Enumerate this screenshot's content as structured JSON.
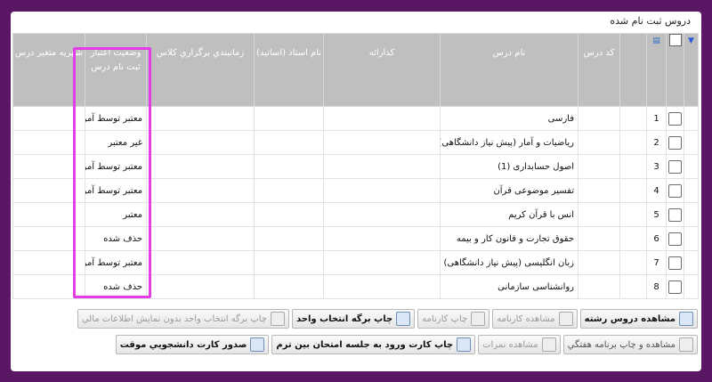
{
  "panel": {
    "title": "دروس ثبت نام شده"
  },
  "table": {
    "headers": {
      "code": "کد درس",
      "name": "نام درس",
      "group": "کدارائه",
      "instructor": "نام استاد (اساتید)",
      "schedule": "زمانبندي برگزاري كلاس",
      "status": "وضعيت اعتبار ثبت نام درس",
      "tuition": "شهريه متغير درس"
    },
    "rows": [
      {
        "num": "1",
        "name": "فارسی",
        "status": "معتبر توسط آموزش"
      },
      {
        "num": "2",
        "name": "رياضيات و آمار (پيش نياز دانشگاهی)",
        "status": "غير معتبر"
      },
      {
        "num": "3",
        "name": "اصول حسابداری (1)",
        "status": "معتبر توسط آموزش"
      },
      {
        "num": "4",
        "name": "تفسير موضوعی قرآن",
        "status": "معتبر توسط آموزش"
      },
      {
        "num": "5",
        "name": "انس با قرآن کريم",
        "status": "معتبر"
      },
      {
        "num": "6",
        "name": "حقوق تجارت و قانون کار و بيمه",
        "status": "حذف شده"
      },
      {
        "num": "7",
        "name": "زبان انگليسی (پيش نياز دانشگاهی)",
        "status": "معتبر توسط آموزش"
      },
      {
        "num": "8",
        "name": "روانشناسی سازمانی",
        "status": "حذف شده"
      }
    ]
  },
  "toolbar": {
    "row1": [
      "مشاهده دروس رشته",
      "مشاهده کارنامه",
      "چاپ کارنامه",
      "چاپ برگه انتخاب واحد",
      "چاپ برگه انتخاب واحد بدون نمايش اطلاعات مالي"
    ],
    "row2": [
      "مشاهده و چاپ برنامه هفتگي",
      "مشاهده نمرات",
      "چاپ کارت ورود به جلسه امتحان بين ترم",
      "صدور کارت دانشجويي موقت"
    ]
  },
  "colors": {
    "background": "#5a1763",
    "header": "#bfbfbf",
    "highlight": "#e33de6"
  }
}
